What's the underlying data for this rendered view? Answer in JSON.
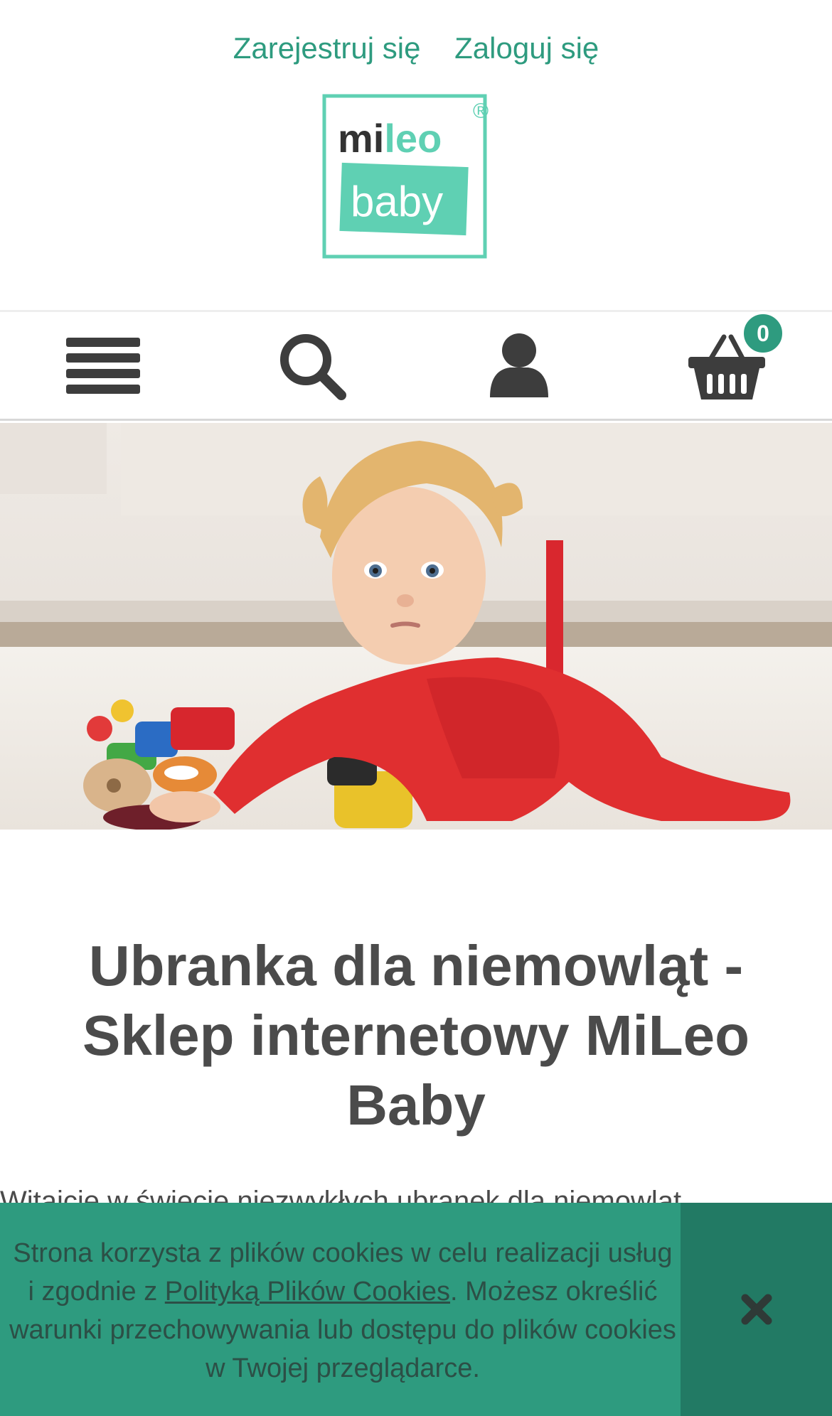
{
  "header": {
    "register_label": "Zarejestruj się",
    "login_label": "Zaloguj się",
    "logo_line1_dark": "mi",
    "logo_line1_light": "leo",
    "logo_line2": "baby",
    "logo_mark": "®"
  },
  "navbar": {
    "icons": [
      "menu-icon",
      "search-icon",
      "user-icon",
      "basket-icon"
    ],
    "cart_count": "0"
  },
  "colors": {
    "brand_green": "#2e9b7f",
    "logo_mint": "#5fd0b3",
    "text_dark": "#4a4a4a",
    "cookie_bg": "#2e9b7f",
    "cookie_close_bg": "#227a64"
  },
  "main": {
    "title": "Ubranka dla niemowląt - Sklep internetowy MiLeo Baby",
    "intro_partial": "Witajcie w świecie niezwykłych ubranek dla niemowląt"
  },
  "cookie_banner": {
    "text_before": "Strona korzysta z plików cookies w celu realizacji usług i zgodnie z ",
    "link_label": "Polityką Plików Cookies",
    "text_after": ". Możesz określić warunki przechowywania lub dostępu do plików cookies w Twojej przeglądarce.",
    "close_icon": "close-icon"
  }
}
